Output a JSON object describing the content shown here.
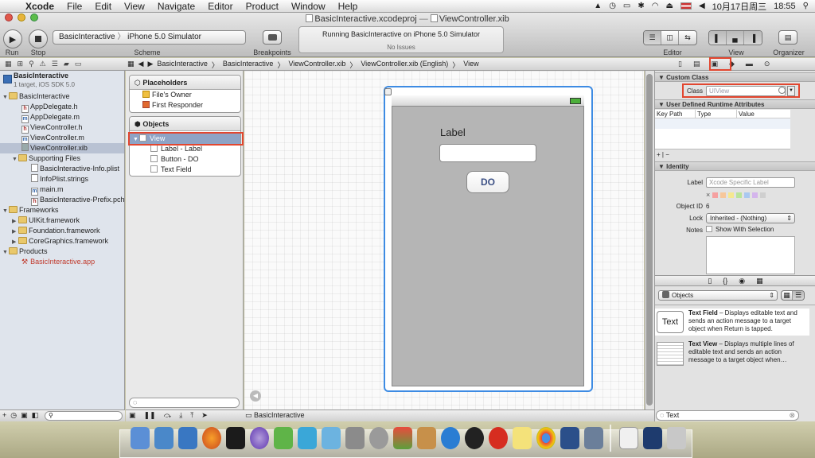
{
  "menubar": {
    "app": "Xcode",
    "items": [
      "File",
      "Edit",
      "View",
      "Navigate",
      "Editor",
      "Product",
      "Window",
      "Help"
    ],
    "clock": "10月17日周三",
    "time": "18:55"
  },
  "window": {
    "title_project": "BasicInteractive.xcodeproj",
    "title_sep": "—",
    "title_file": "ViewController.xib"
  },
  "toolbar": {
    "run": "Run",
    "stop": "Stop",
    "scheme_label": "Scheme",
    "scheme_target": "BasicInteractive",
    "scheme_device": "iPhone 5.0 Simulator",
    "breakpoints": "Breakpoints",
    "status_main": "Running BasicInteractive on iPhone 5.0 Simulator",
    "status_sub": "No Issues",
    "editor": "Editor",
    "view": "View",
    "organizer": "Organizer"
  },
  "jumpbar": {
    "crumbs": [
      "BasicInteractive",
      "BasicInteractive",
      "ViewController.xib",
      "ViewController.xib (English)",
      "View"
    ]
  },
  "navigator": {
    "project": "BasicInteractive",
    "project_sub": "1 target, iOS SDK 5.0",
    "items": [
      {
        "label": "BasicInteractive",
        "kind": "folder"
      },
      {
        "label": "AppDelegate.h",
        "kind": "h"
      },
      {
        "label": "AppDelegate.m",
        "kind": "m"
      },
      {
        "label": "ViewController.h",
        "kind": "h"
      },
      {
        "label": "ViewController.m",
        "kind": "m"
      },
      {
        "label": "ViewController.xib",
        "kind": "xib"
      },
      {
        "label": "Supporting Files",
        "kind": "folder"
      },
      {
        "label": "BasicInteractive-Info.plist",
        "kind": "file"
      },
      {
        "label": "InfoPlist.strings",
        "kind": "file"
      },
      {
        "label": "main.m",
        "kind": "m"
      },
      {
        "label": "BasicInteractive-Prefix.pch",
        "kind": "h"
      },
      {
        "label": "Frameworks",
        "kind": "folder"
      },
      {
        "label": "UIKit.framework",
        "kind": "fw"
      },
      {
        "label": "Foundation.framework",
        "kind": "fw"
      },
      {
        "label": "CoreGraphics.framework",
        "kind": "fw"
      },
      {
        "label": "Products",
        "kind": "folder"
      },
      {
        "label": "BasicInteractive.app",
        "kind": "app"
      }
    ]
  },
  "outline": {
    "placeholders_title": "Placeholders",
    "placeholders": [
      "File's Owner",
      "First Responder"
    ],
    "objects_title": "Objects",
    "view": "View",
    "children": [
      "Label - Label",
      "Button - DO",
      "Text Field"
    ]
  },
  "canvas": {
    "label": "Label",
    "button": "DO"
  },
  "debug": {
    "target": "BasicInteractive"
  },
  "inspector": {
    "custom_class_title": "Custom Class",
    "class_label": "Class",
    "class_placeholder": "UIView",
    "udra_title": "User Defined Runtime Attributes",
    "cols": [
      "Key Path",
      "Type",
      "Value"
    ],
    "identity_title": "Identity",
    "label_label": "Label",
    "label_placeholder": "Xcode Specific Label",
    "object_id_label": "Object ID",
    "object_id": "6",
    "lock_label": "Lock",
    "lock_value": "Inherited - (Nothing)",
    "notes_label": "Notes",
    "show_with_selection": "Show With Selection"
  },
  "library": {
    "selector": "Objects",
    "items": [
      {
        "title": "Text Field",
        "desc": " – Displays editable text and sends an action message to a target object when Return is tapped.",
        "thumb": "Text"
      },
      {
        "title": "Text View",
        "desc": " – Displays multiple lines of editable text and sends an action message to a target object when…",
        "thumb": ""
      }
    ],
    "filter": "Text"
  }
}
